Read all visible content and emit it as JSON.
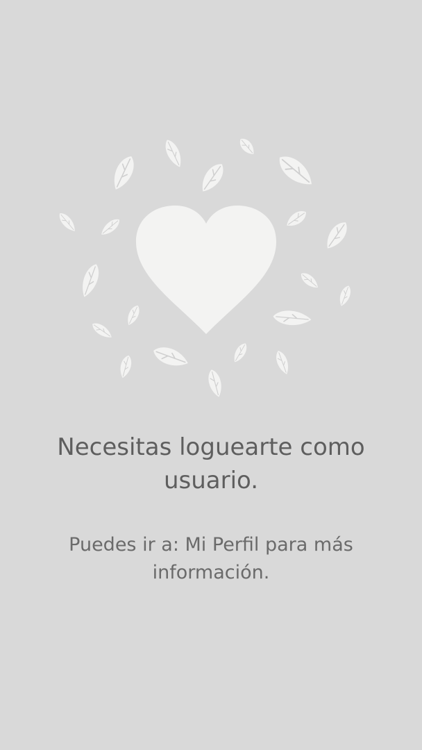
{
  "colors": {
    "background": "#d9d9d9",
    "illustration": "#f3f3f2",
    "leaf_vein": "#cfcfcf",
    "text_primary": "#5e5e5e",
    "text_secondary": "#6a6a6a"
  },
  "illustration": {
    "icon": "heart-with-leaves-icon"
  },
  "message": {
    "title": "Necesitas loguearte como usuario.",
    "subtitle": "Puedes ir a: Mi Perfil para más información."
  }
}
